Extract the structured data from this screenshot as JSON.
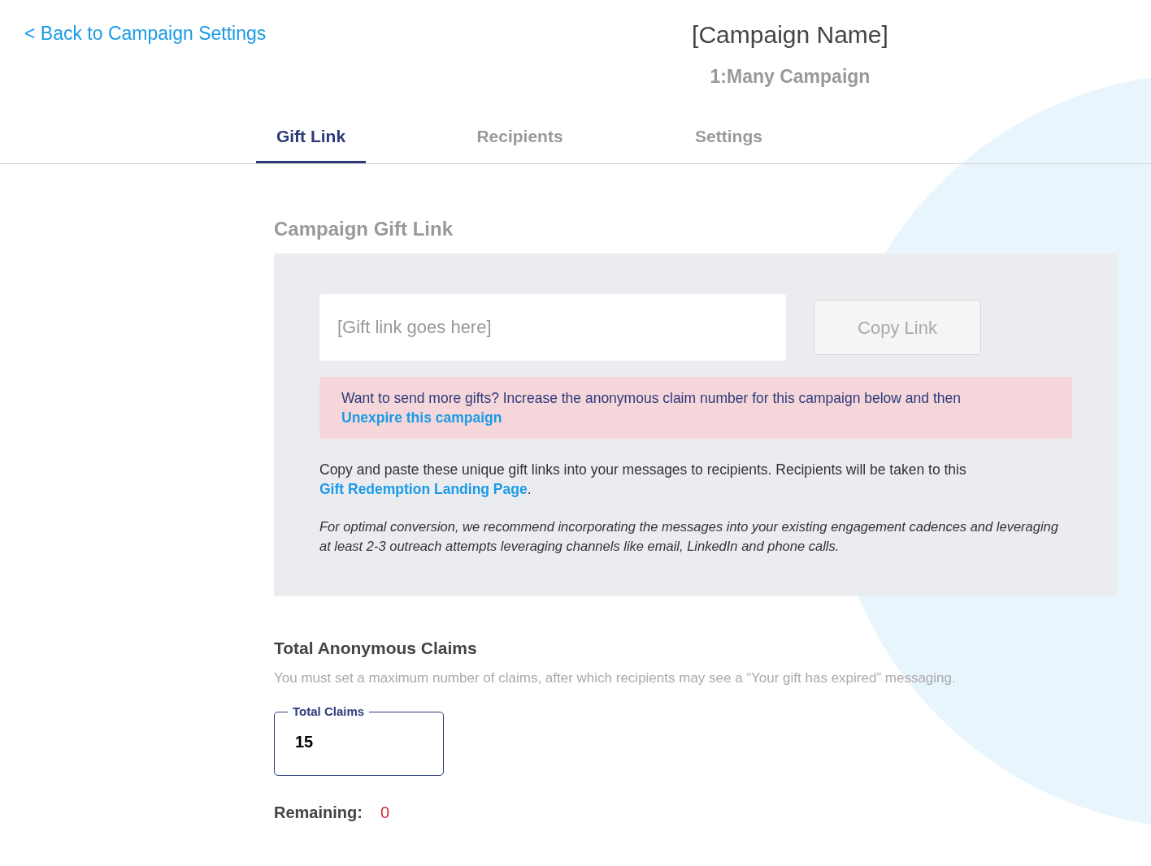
{
  "back_link": "< Back to Campaign Settings",
  "header": {
    "title": "[Campaign Name]",
    "subtitle": "1:Many Campaign"
  },
  "tabs": [
    {
      "label": "Gift Link",
      "selected": true
    },
    {
      "label": "Recipients",
      "selected": false
    },
    {
      "label": "Settings",
      "selected": false
    }
  ],
  "gift_link_section": {
    "heading": "Campaign Gift Link",
    "link_field": {
      "placeholder": "[Gift link goes here]"
    },
    "copy_button": {
      "label": "Copy Link",
      "disabled": true
    },
    "notice": {
      "text": "Want to send more gifts? Increase the anonymous claim number for this campaign below and then",
      "link": "Unexpire this campaign"
    },
    "instructions": {
      "text": "Copy and paste these unique gift links into your messages to recipients. Recipients will be taken to this",
      "link": "Gift Redemption Landing Page",
      "after": "."
    },
    "tip": "For optimal conversion, we recommend incorporating the messages into your existing engagement cadences and leveraging at least 2-3 outreach attempts leveraging channels like email, LinkedIn and phone calls."
  },
  "claims_section": {
    "heading": "Total Anonymous Claims",
    "description": "You must set a maximum number of claims, after which recipients may see a “Your gift has expired” messaging.",
    "total_claims_field": {
      "label": "Total Claims",
      "value": "15"
    },
    "remaining_label": "Remaining:",
    "remaining_value": "0"
  }
}
